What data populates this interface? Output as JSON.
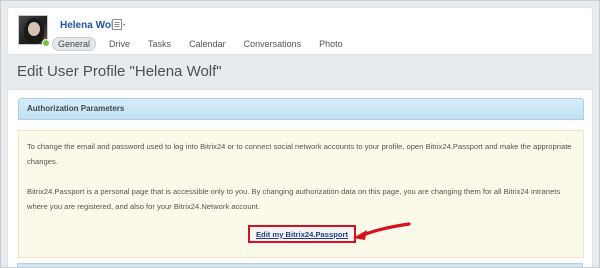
{
  "profile": {
    "name": "Helena Wolf",
    "tabs": [
      {
        "label": "General"
      },
      {
        "label": "Drive"
      },
      {
        "label": "Tasks"
      },
      {
        "label": "Calendar"
      },
      {
        "label": "Conversations"
      },
      {
        "label": "Photo"
      }
    ]
  },
  "page": {
    "title": "Edit User Profile \"Helena Wolf\""
  },
  "section": {
    "title": "Authorization Parameters",
    "paragraph1": "To change the email and password used to log into Bitrix24 or to connect social network accounts to your profile, open Bitrix24.Passport and make the appropriate changes.",
    "paragraph2": "Bitrix24.Passport is a personal page that is accessible only to you. By changing authorization data on this page, you are changing them for all Bitrix24 intranets where you are registered, and also for your Bitrix24.Network account.",
    "passport_link": "Edit my Bitrix24.Passport"
  },
  "colors": {
    "highlight": "#d7101d",
    "link": "#1d56a6",
    "status_online": "#7cc43b"
  },
  "icons": [
    "menu-icon",
    "online-status-icon",
    "arrow-icon"
  ]
}
